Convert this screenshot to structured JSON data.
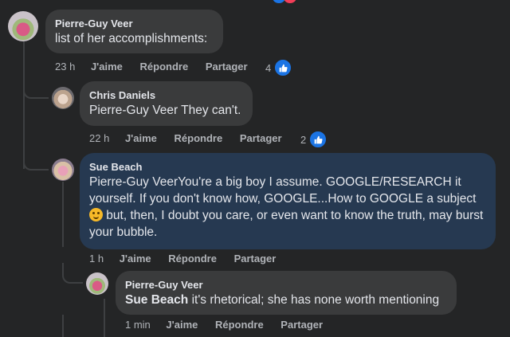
{
  "comments": [
    {
      "author": "Pierre-Guy Veer",
      "text": "list of her accomplishments:",
      "time": "23 h",
      "reaction_count": "4"
    },
    {
      "author": "Chris Daniels",
      "mention": "",
      "text": "Pierre-Guy Veer They can't.",
      "time": "22 h",
      "reaction_count": "2"
    },
    {
      "author": "Sue Beach",
      "text_part1": "Pierre-Guy VeerYou're a big boy I assume. GOOGLE/RESEARCH it yourself. If you don't know how, GOOGLE...How to GOOGLE a subject ",
      "text_part2": " but, then, I doubt you care, or even want to know the truth, may burst your bubble.",
      "time": "1 h"
    },
    {
      "author": "Pierre-Guy Veer",
      "mention": "Sue Beach",
      "text": " it's rhetorical; she has none worth mentioning",
      "time": "1 min"
    }
  ],
  "actions": {
    "like": "J'aime",
    "reply": "Répondre",
    "share": "Partager"
  },
  "icons": {
    "like": "like-thumb-icon",
    "emoji": "smirk-emoji-icon"
  },
  "colors": {
    "background": "#242526",
    "bubble": "#3a3b3c",
    "highlight_bubble": "#263951",
    "like_blue": "#1b74e4"
  }
}
